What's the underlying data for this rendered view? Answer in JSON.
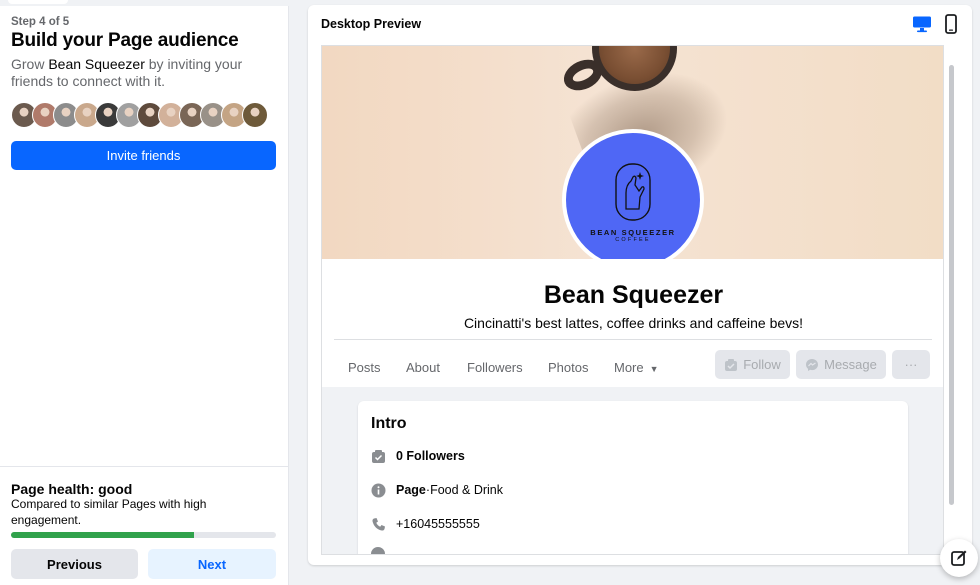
{
  "left": {
    "step": "Step 4 of 5",
    "title": "Build your Page audience",
    "desc_prefix": "Grow ",
    "desc_page_name": "Bean Squeezer",
    "desc_suffix": " by inviting your friends to connect with it.",
    "invite_label": "Invite friends",
    "friend_avatar_count": 12
  },
  "health": {
    "title": "Page health: good",
    "desc": "Compared to similar Pages with high engagement.",
    "progress_fraction": 0.69,
    "progress_color": "#31a24c"
  },
  "nav": {
    "previous_label": "Previous",
    "next_label": "Next"
  },
  "preview": {
    "title": "Desktop Preview",
    "devices": [
      {
        "icon": "desktop-icon",
        "active": true
      },
      {
        "icon": "mobile-icon",
        "active": false
      }
    ]
  },
  "page": {
    "name": "Bean Squeezer",
    "bio": "Cincinatti's best lattes, coffee drinks and caffeine bevs!",
    "logo_line1": "BEAN SQUEEZER",
    "logo_line2": "COFFEE",
    "logo_color": "#4f67f5",
    "tabs": [
      "Posts",
      "About",
      "Followers",
      "Photos",
      "More"
    ],
    "actions": {
      "follow": "Follow",
      "message": "Message",
      "more": "···"
    }
  },
  "intro": {
    "title": "Intro",
    "followers": "0 Followers",
    "category_label": "Page",
    "category_sep": " · ",
    "category_value": "Food & Drink",
    "phone": "+16045555555"
  },
  "colors": {
    "primary": "#0866ff",
    "soft_primary": "#e7f3ff",
    "secondary_text": "#65676b"
  }
}
